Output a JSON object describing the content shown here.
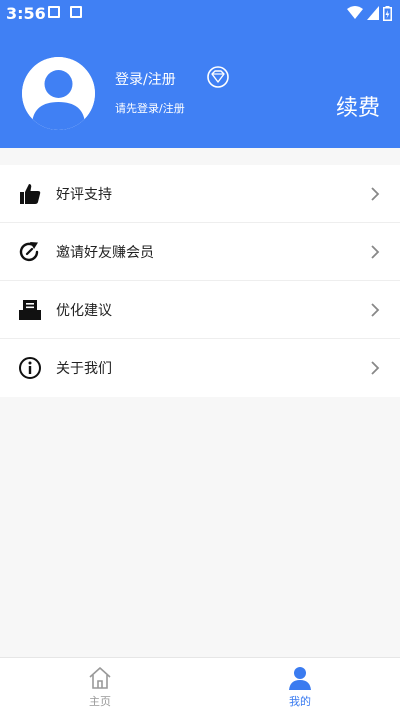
{
  "status_bar": {
    "time": "3:56"
  },
  "profile": {
    "login_title": "登录/注册",
    "login_subtitle": "请先登录/注册",
    "renew_label": "续费"
  },
  "menu": {
    "items": [
      {
        "label": "好评支持",
        "icon": "thumbs-up-icon"
      },
      {
        "label": "邀请好友赚会员",
        "icon": "share-refresh-icon"
      },
      {
        "label": "优化建议",
        "icon": "inbox-icon"
      },
      {
        "label": "关于我们",
        "icon": "info-icon"
      }
    ]
  },
  "bottom_nav": {
    "tabs": [
      {
        "label": "主页",
        "icon": "home-icon",
        "active": false
      },
      {
        "label": "我的",
        "icon": "person-icon",
        "active": true
      }
    ]
  },
  "colors": {
    "brand": "#4080f4",
    "inactive_tab": "#999999",
    "active_tab": "#3a7bf0"
  }
}
